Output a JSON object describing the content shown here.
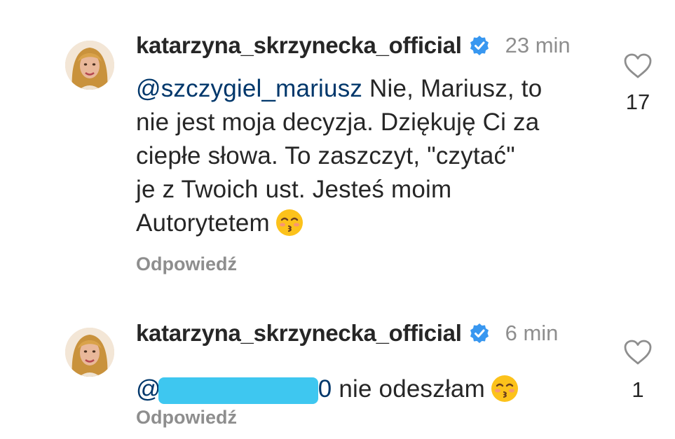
{
  "comments": [
    {
      "username": "katarzyna_skrzynecka_official",
      "time": "23 min",
      "mention": "@szczygiel_mariusz",
      "line1_rest": " Nie, Mariusz, to",
      "line2": "nie jest moja decyzja. Dziękuję Ci za",
      "line3": "ciepłe słowa. To zaszczyt, \"czytać\"",
      "line4": "je z Twoich ust. Jesteś moim",
      "line5": "Autorytetem",
      "reply": "Odpowiedź",
      "likes": "17"
    },
    {
      "username": "katarzyna_skrzynecka_official",
      "time": "6 min",
      "mention_start": "@",
      "mention_end": "0",
      "text": " nie odeszłam",
      "reply": "Odpowiedź",
      "likes": "1"
    }
  ],
  "colors": {
    "verified": "#3897f0",
    "mention": "#00376b",
    "muted": "#8e8e8e",
    "redaction": "#3ec7f0"
  },
  "icons": [
    "avatar",
    "verified-badge-icon",
    "kissing-face-emoji",
    "heart-outline-icon"
  ]
}
